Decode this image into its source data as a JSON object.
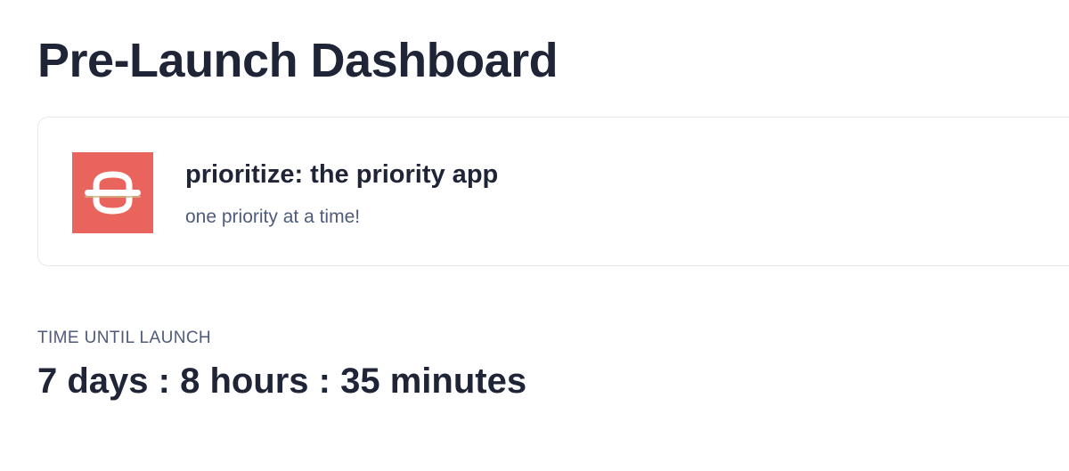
{
  "header": {
    "title": "Pre-Launch Dashboard"
  },
  "product": {
    "name": "prioritize: the priority app",
    "tagline": "one priority at a time!",
    "logo_icon": "prioritize-logo-icon",
    "logo_color": "#e8645c"
  },
  "countdown": {
    "label": "TIME UNTIL LAUNCH",
    "value": "7 days : 8 hours : 35 minutes"
  },
  "colors": {
    "text_primary": "#1f2537",
    "text_secondary": "#4f5b7a",
    "card_border": "#e6e8ee"
  }
}
